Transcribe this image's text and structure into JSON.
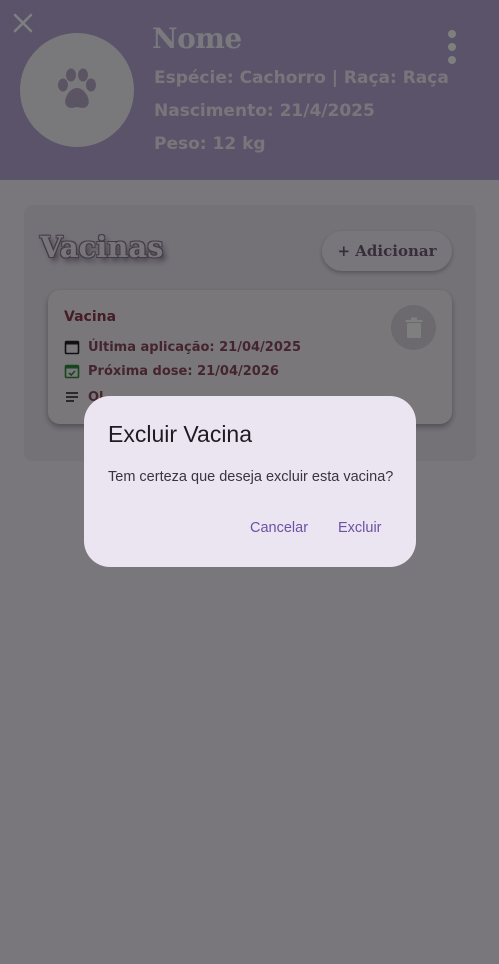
{
  "header": {
    "pet_name": "Nome",
    "species_breed": "Espécie: Cachorro | Raça: Raça",
    "birth": "Nascimento: 21/4/2025",
    "weight": "Peso: 12 kg",
    "icons": {
      "close": "close-icon",
      "avatar": "paw-icon",
      "more": "more-vert-icon"
    }
  },
  "vaccines": {
    "title": "Vacinas",
    "add_label": "+ Adicionar",
    "items": [
      {
        "name": "Vacina",
        "last_application": "Última aplicação: 21/04/2025",
        "next_dose": "Próxima dose: 21/04/2026",
        "notes_partial": "Ol"
      }
    ]
  },
  "dialog": {
    "title": "Excluir Vacina",
    "message": "Tem certeza que deseja excluir esta vacina?",
    "cancel_label": "Cancelar",
    "confirm_label": "Excluir"
  },
  "colors": {
    "header_bg": "#b4a6d3",
    "accent": "#6b52a4",
    "next_dose_icon": "#2e8b3a",
    "scrim": "rgba(0,0,0,0.5)"
  }
}
